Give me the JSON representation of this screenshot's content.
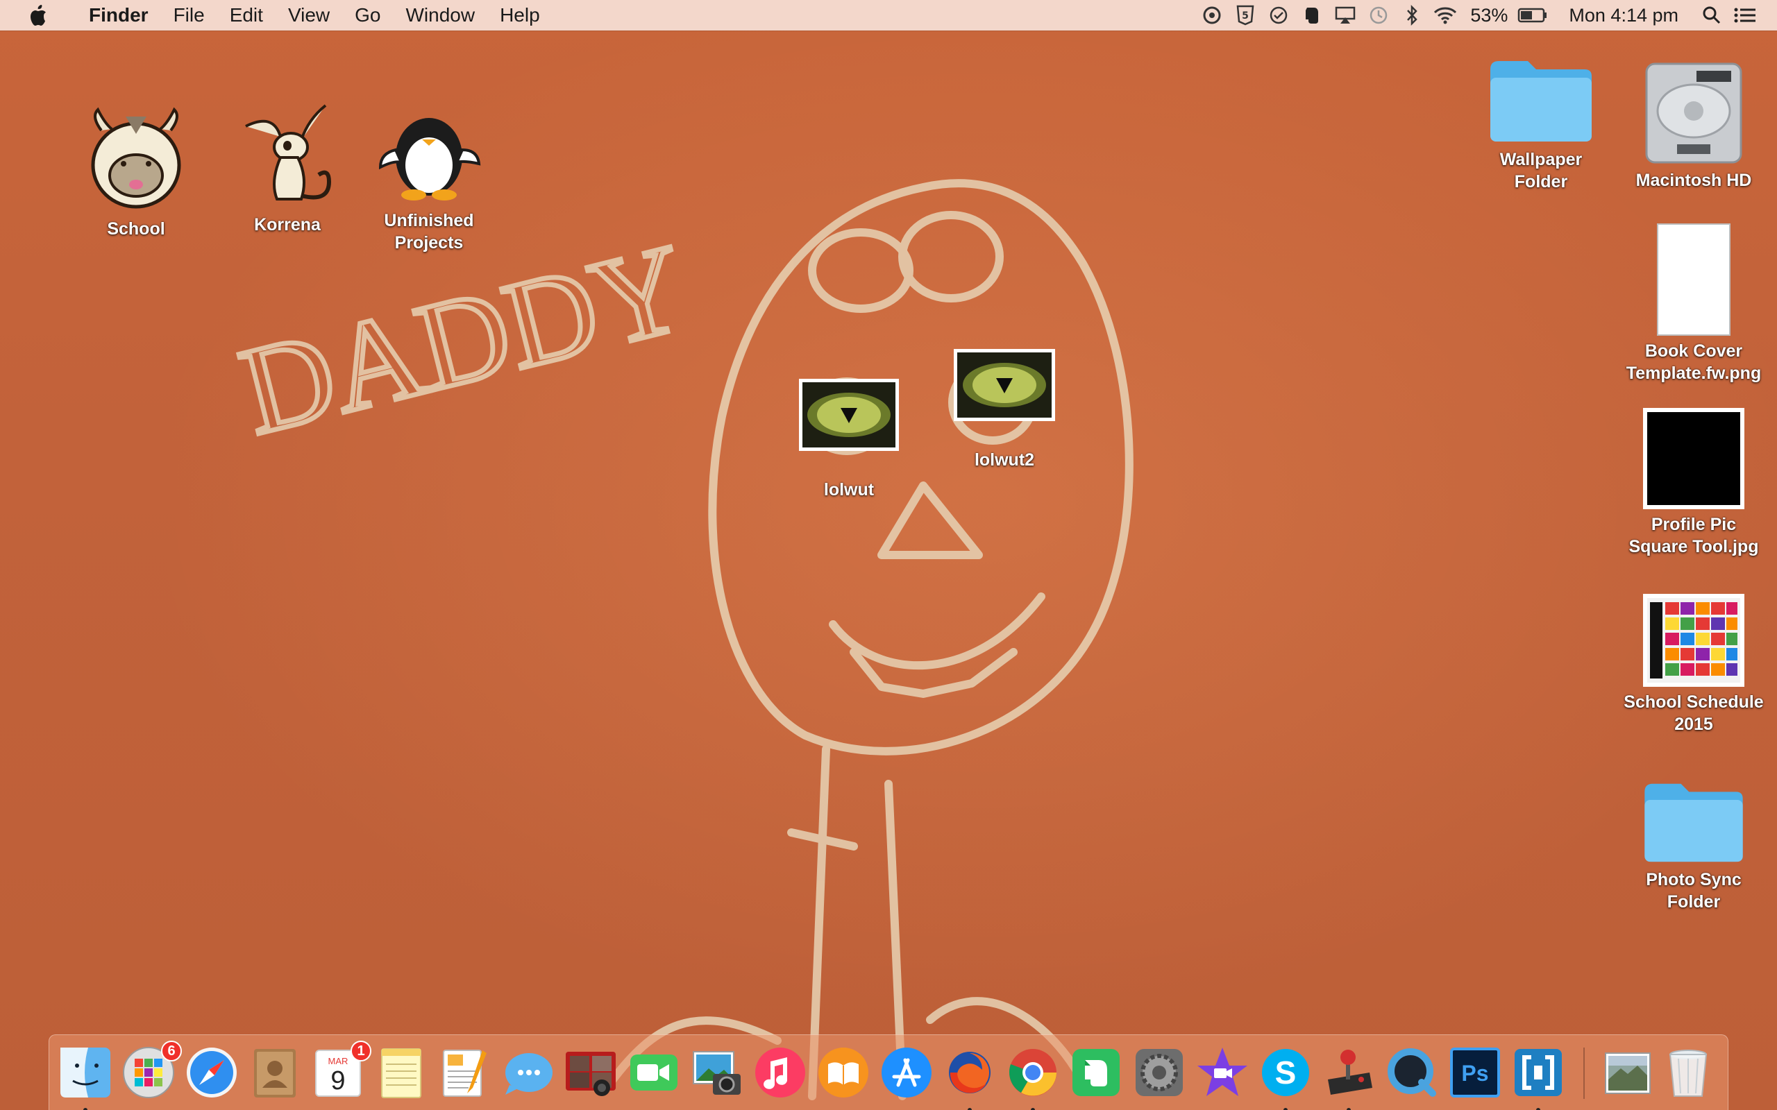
{
  "menubar": {
    "app_name": "Finder",
    "items": [
      "File",
      "Edit",
      "View",
      "Go",
      "Window",
      "Help"
    ],
    "battery_percent": "53%",
    "clock": "Mon 4:14 pm",
    "status_icons": [
      "crossover-icon",
      "html5-icon",
      "wunderlist-icon",
      "evernote-icon",
      "airplay-icon",
      "time-machine-icon",
      "bluetooth-icon",
      "wifi-icon"
    ]
  },
  "desktop_icons": {
    "school": "School",
    "korrena": "Korrena",
    "unfinished_projects": "Unfinished\nProjects",
    "lolwut": "lolwut",
    "lolwut2": "lolwut2",
    "wallpaper_folder": "Wallpaper\nFolder",
    "macintosh_hd": "Macintosh HD",
    "book_cover": "Book Cover\nTemplate.fw.png",
    "profile_pic": "Profile Pic\nSquare Tool.jpg",
    "school_schedule": "School Schedule\n2015",
    "photo_sync": "Photo Sync\nFolder"
  },
  "wallpaper": {
    "text": "DADDY"
  },
  "dock": {
    "apps": [
      "Finder",
      "Launchpad",
      "Safari",
      "Contacts",
      "Calendar",
      "Notes",
      "Pages",
      "Messages",
      "Photo Booth",
      "FaceTime",
      "iPhoto",
      "iTunes",
      "iBooks",
      "App Store",
      "Firefox",
      "Chrome",
      "Evernote",
      "System Preferences",
      "iMovie",
      "Skype",
      "Joystick",
      "QuickTime",
      "Photoshop",
      "Brackets"
    ],
    "launchpad_badge": "6",
    "calendar_badge": "1",
    "calendar_month": "MAR",
    "calendar_day": "9",
    "photoshop_label": "Ps",
    "skype_label": "S"
  },
  "colors": {
    "wallpaper": "#c2623a",
    "menubar": "#f6e0d6",
    "folder_blue": "#6fc3f2",
    "badge_red": "#f0302a"
  }
}
